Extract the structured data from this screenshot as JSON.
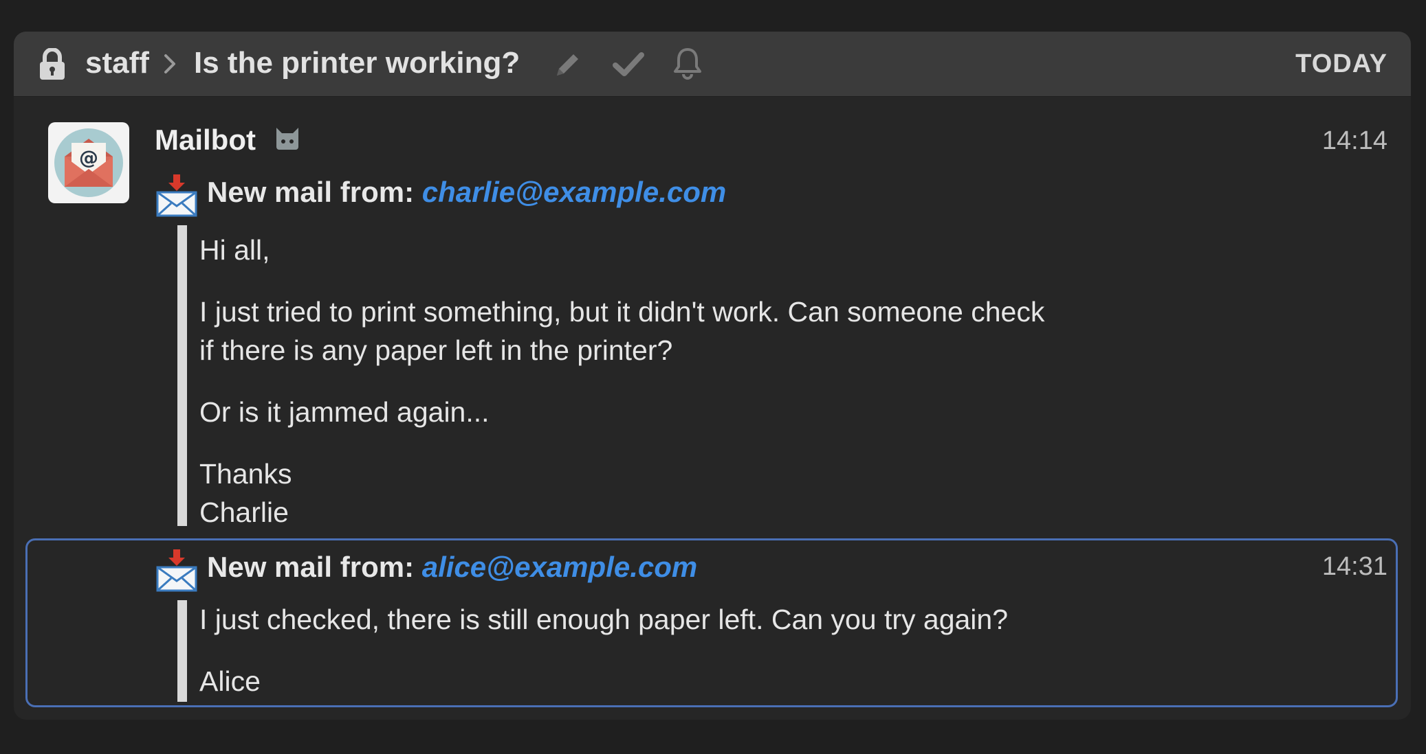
{
  "header": {
    "stream": "staff",
    "topic": "Is the printer working?",
    "date": "TODAY",
    "icons": [
      "lock-icon",
      "chevron-right-icon",
      "pencil-icon",
      "check-icon",
      "bell-icon"
    ]
  },
  "messages": [
    {
      "sender": "Mailbot",
      "time": "14:14",
      "mail_prefix": "New mail from:",
      "mail_from": "charlie@example.com",
      "lines": [
        "Hi all,",
        "I just tried to print something, but it didn't work. Can someone check",
        "if there is any paper left in the printer?",
        "Or is it jammed again...",
        "Thanks",
        "Charlie"
      ]
    },
    {
      "time": "14:31",
      "mail_prefix": "New mail from:",
      "mail_from": "alice@example.com",
      "lines": [
        "I just checked, there is still enough paper left. Can you try again?",
        "Alice"
      ]
    }
  ],
  "colors": {
    "background": "#1f1f1f",
    "panel": "#262626",
    "header": "#3b3b3b",
    "link": "#3f8ee6",
    "selection_border": "#4a6fb5",
    "quote_bar": "#d9d9d9"
  }
}
